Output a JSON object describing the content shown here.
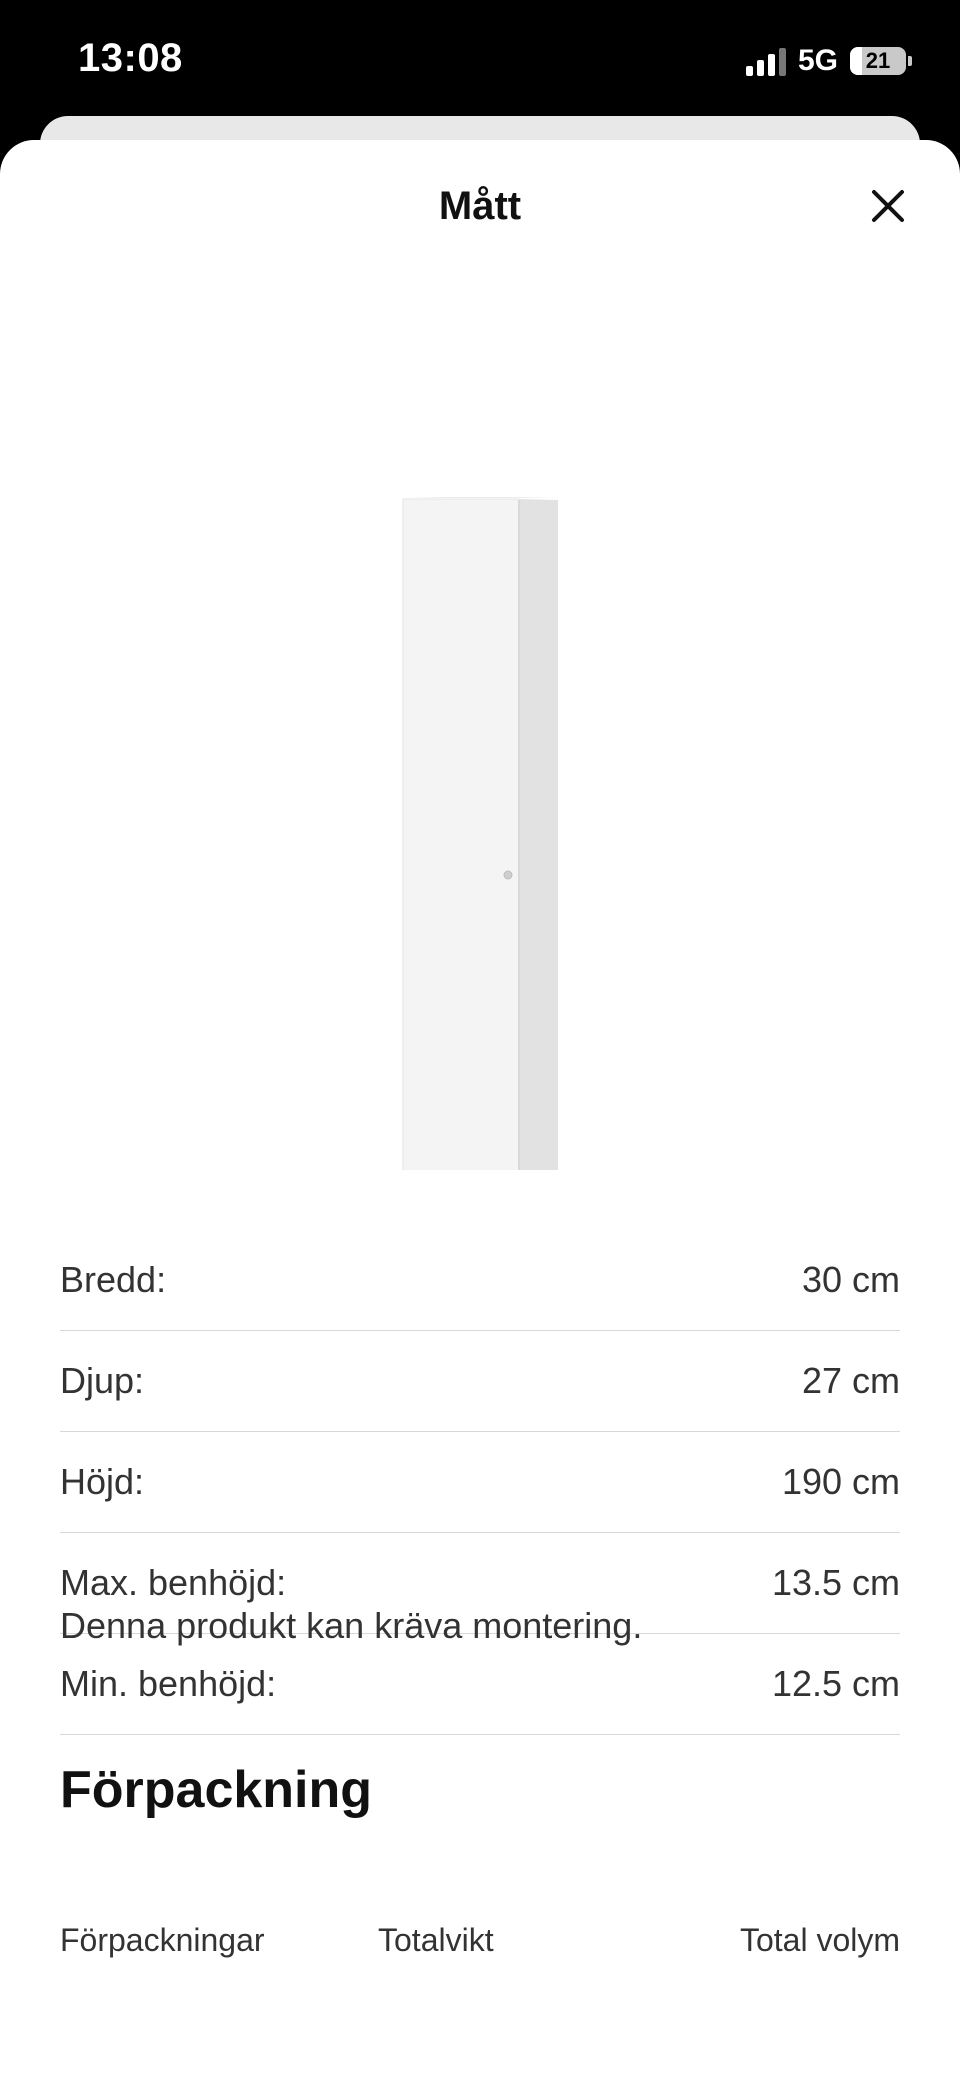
{
  "status_bar": {
    "time": "13:08",
    "network": "5G",
    "battery": "21",
    "battery_level": 0.21
  },
  "sheet": {
    "title": "Mått",
    "close_icon": "close-icon"
  },
  "dimensions": [
    {
      "label": "Bredd:",
      "value": "30 cm"
    },
    {
      "label": "Djup:",
      "value": "27 cm"
    },
    {
      "label": "Höjd:",
      "value": "190 cm"
    },
    {
      "label": "Max. benhöjd:",
      "value": "13.5 cm"
    },
    {
      "label": "Min. benhöjd:",
      "value": "12.5 cm"
    }
  ],
  "assembly_note": "Denna produkt kan kräva montering.",
  "packaging": {
    "heading": "Förpackning",
    "columns": [
      "Förpackningar",
      "Totalvikt",
      "Total volym"
    ]
  },
  "colors": {
    "background": "#ffffff",
    "text": "#111111",
    "divider": "#d8d8d8",
    "status_bar": "#000000"
  }
}
